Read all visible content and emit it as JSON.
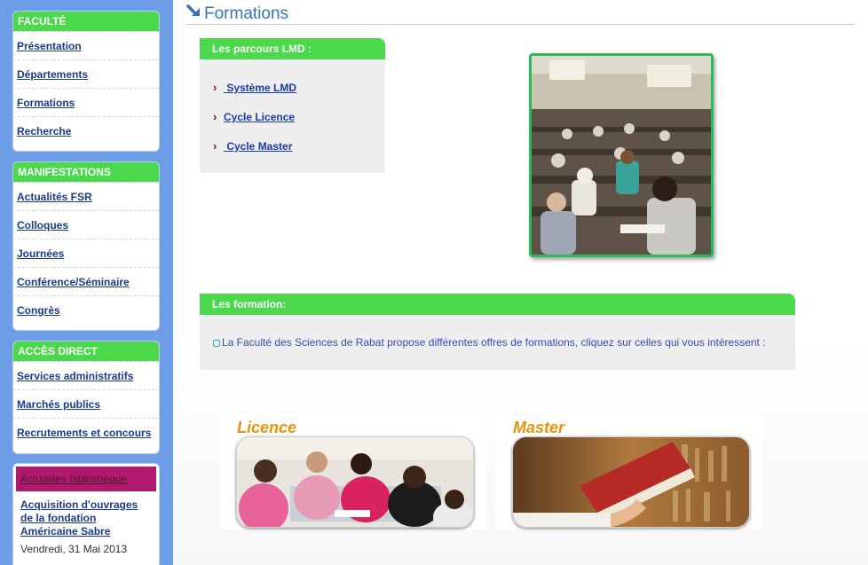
{
  "sidebar": {
    "faculte": {
      "header": "FACULTÉ",
      "items": [
        {
          "label": "Présentation"
        },
        {
          "label": "Départements"
        },
        {
          "label": "Formations"
        },
        {
          "label": "Recherche"
        }
      ]
    },
    "manifestations": {
      "header": "MANIFESTATIONS",
      "items": [
        {
          "label": "Actualités FSR"
        },
        {
          "label": "Colloques"
        },
        {
          "label": "Journées"
        },
        {
          "label": "Conférence/Séminaire"
        },
        {
          "label": "Congrès"
        }
      ]
    },
    "acces": {
      "header": "ACCÈS DIRECT",
      "items": [
        {
          "label": "Services administratifs"
        },
        {
          "label": "Marchés publics"
        },
        {
          "label": "Recrutements et concours"
        }
      ]
    },
    "news": {
      "header": "Actualités bibliothèque",
      "link": "Acquisition d'ouvrages de la fondation Américaine Sabre",
      "date": "Vendredi, 31 Mai 2013"
    }
  },
  "main": {
    "title": "Formations",
    "lmd": {
      "header": "Les parcours LMD :",
      "links": [
        {
          "label": " Système LMD"
        },
        {
          "label": "Cycle Licence"
        },
        {
          "label": " Cycle Master"
        }
      ]
    },
    "formation": {
      "header": "Les formation:",
      "text": "La Faculté des Sciences de Rabat propose différentes offres de formations, cliquez sur celles qui vous intéressent :"
    },
    "cards": [
      {
        "title": "Licence"
      },
      {
        "title": "Master"
      }
    ]
  },
  "colors": {
    "sidebar_bg": "#6d9de6",
    "green_header": "#4ad94a",
    "title_blue": "#3a74bd",
    "card_title_orange": "#e8920e",
    "news_header": "#b0196e"
  },
  "icons": {
    "title": "arrow-down-right-icon",
    "lmd_bullet": "chevron-right-icon",
    "formation_bullet": "square-bullet-icon"
  }
}
